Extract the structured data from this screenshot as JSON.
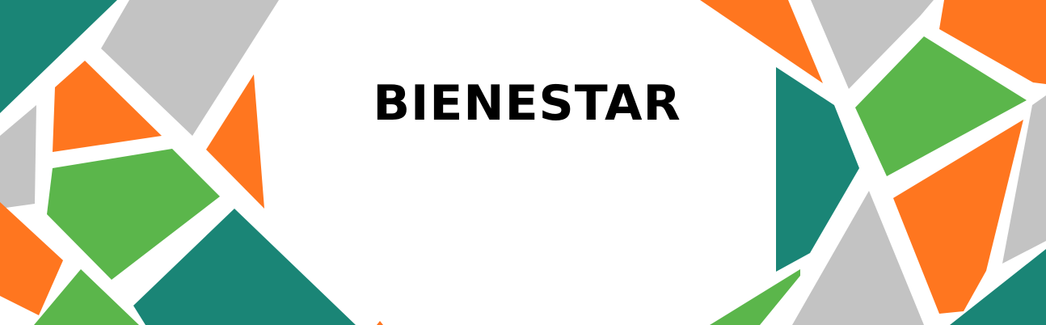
{
  "banner": {
    "title": "BIENESTAR"
  },
  "colors": {
    "background": "#ffffff",
    "title": "#000000",
    "teal": "#1a8576",
    "orange": "#ff761f",
    "green": "#5bb64b",
    "gray": "#c3c3c3"
  }
}
